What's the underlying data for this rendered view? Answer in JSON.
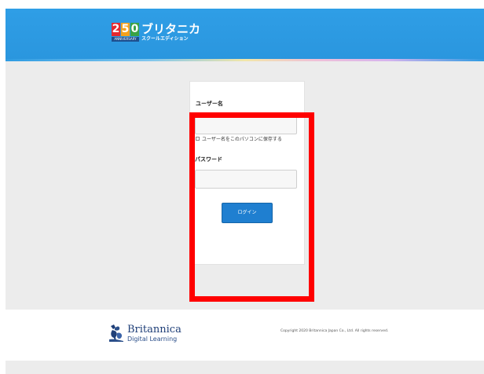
{
  "header": {
    "logo": {
      "digits": [
        "2",
        "5",
        "0"
      ],
      "tagline": "ANNIVERSARY",
      "title": "ブリタニカ",
      "edition": "スクールエディション"
    },
    "colors": {
      "header_blue": "#2f9ee6",
      "button_blue": "#1f7fd0",
      "highlight_red": "#ff0000"
    }
  },
  "login": {
    "username_label": "ユーザー名",
    "username_value": "",
    "remember_label": "ユーザー名をこのパソコンに保存する",
    "remember_checked": false,
    "password_label": "パスワード",
    "password_value": "",
    "login_button": "ログイン"
  },
  "footer": {
    "brand_name": "Britannica",
    "brand_sub": "Digital Learning",
    "brand_icon": "thistle-icon",
    "copyright": "Copyright 2020 Britannica Japan Co., Ltd. All rights reserved."
  }
}
